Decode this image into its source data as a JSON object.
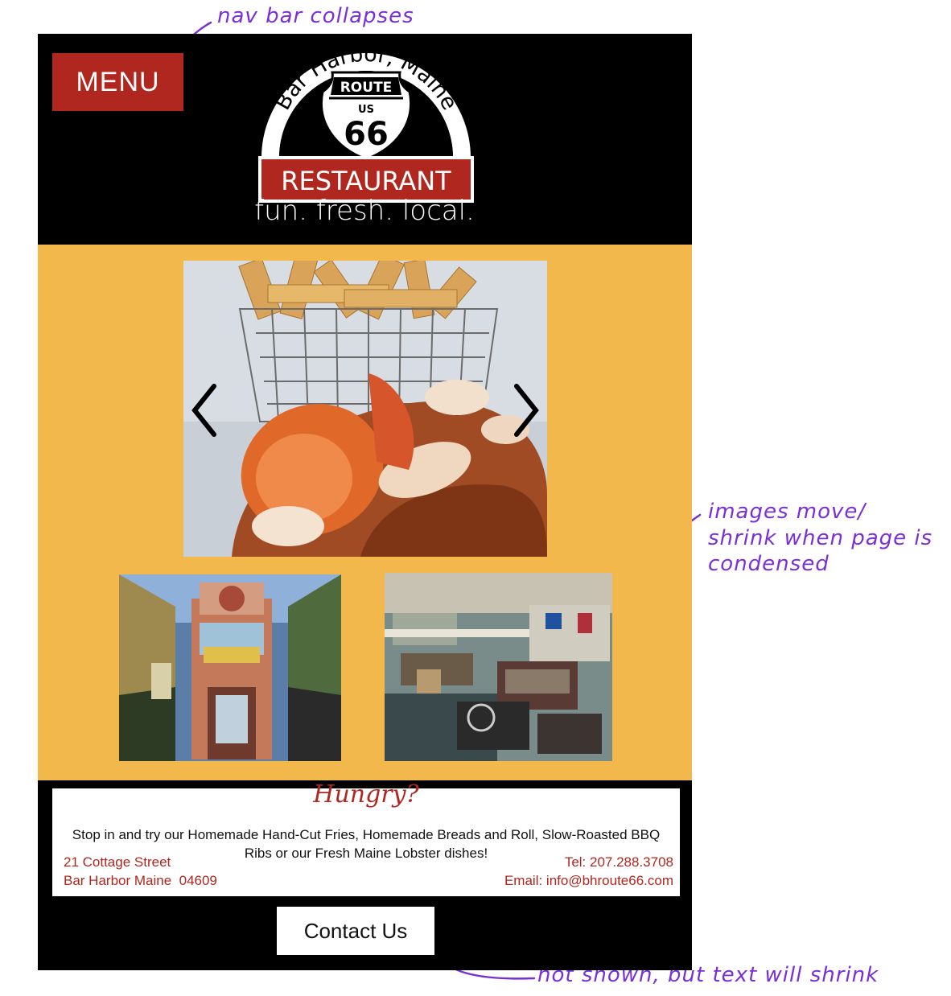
{
  "annotations": {
    "nav": "nav bar collapses",
    "images": "images move/ shrink when page is condensed",
    "text": "not shown, but text will shrink"
  },
  "header": {
    "menu_label": "MENU",
    "logo": {
      "arc_text": "Bar Harbor, Maine",
      "shield_top": "ROUTE",
      "shield_mid": "US",
      "shield_num": "66",
      "banner": "RESTAURANT"
    },
    "tagline": "fun. fresh. local."
  },
  "gallery": {
    "carousel_image": "lobster-roll-with-fries",
    "photos": [
      "restaurant-street-front",
      "restaurant-interior"
    ]
  },
  "info": {
    "heading": "Hungry?",
    "blurb": "Stop in and try our Homemade Hand-Cut Fries, Homemade Breads and Roll, Slow-Roasted BBQ Ribs or our Fresh Maine Lobster dishes!",
    "address_line1": "21 Cottage Street",
    "address_line2": "Bar Harbor Maine  04609",
    "phone": "Tel: 207.288.3708",
    "email": "Email: info@bhroute66.com"
  },
  "contact_label": "Contact Us",
  "colors": {
    "brand_red": "#b0271f",
    "gallery_bg": "#f2b84b",
    "header_bg": "#000000",
    "annotation": "#7a2fd6"
  }
}
